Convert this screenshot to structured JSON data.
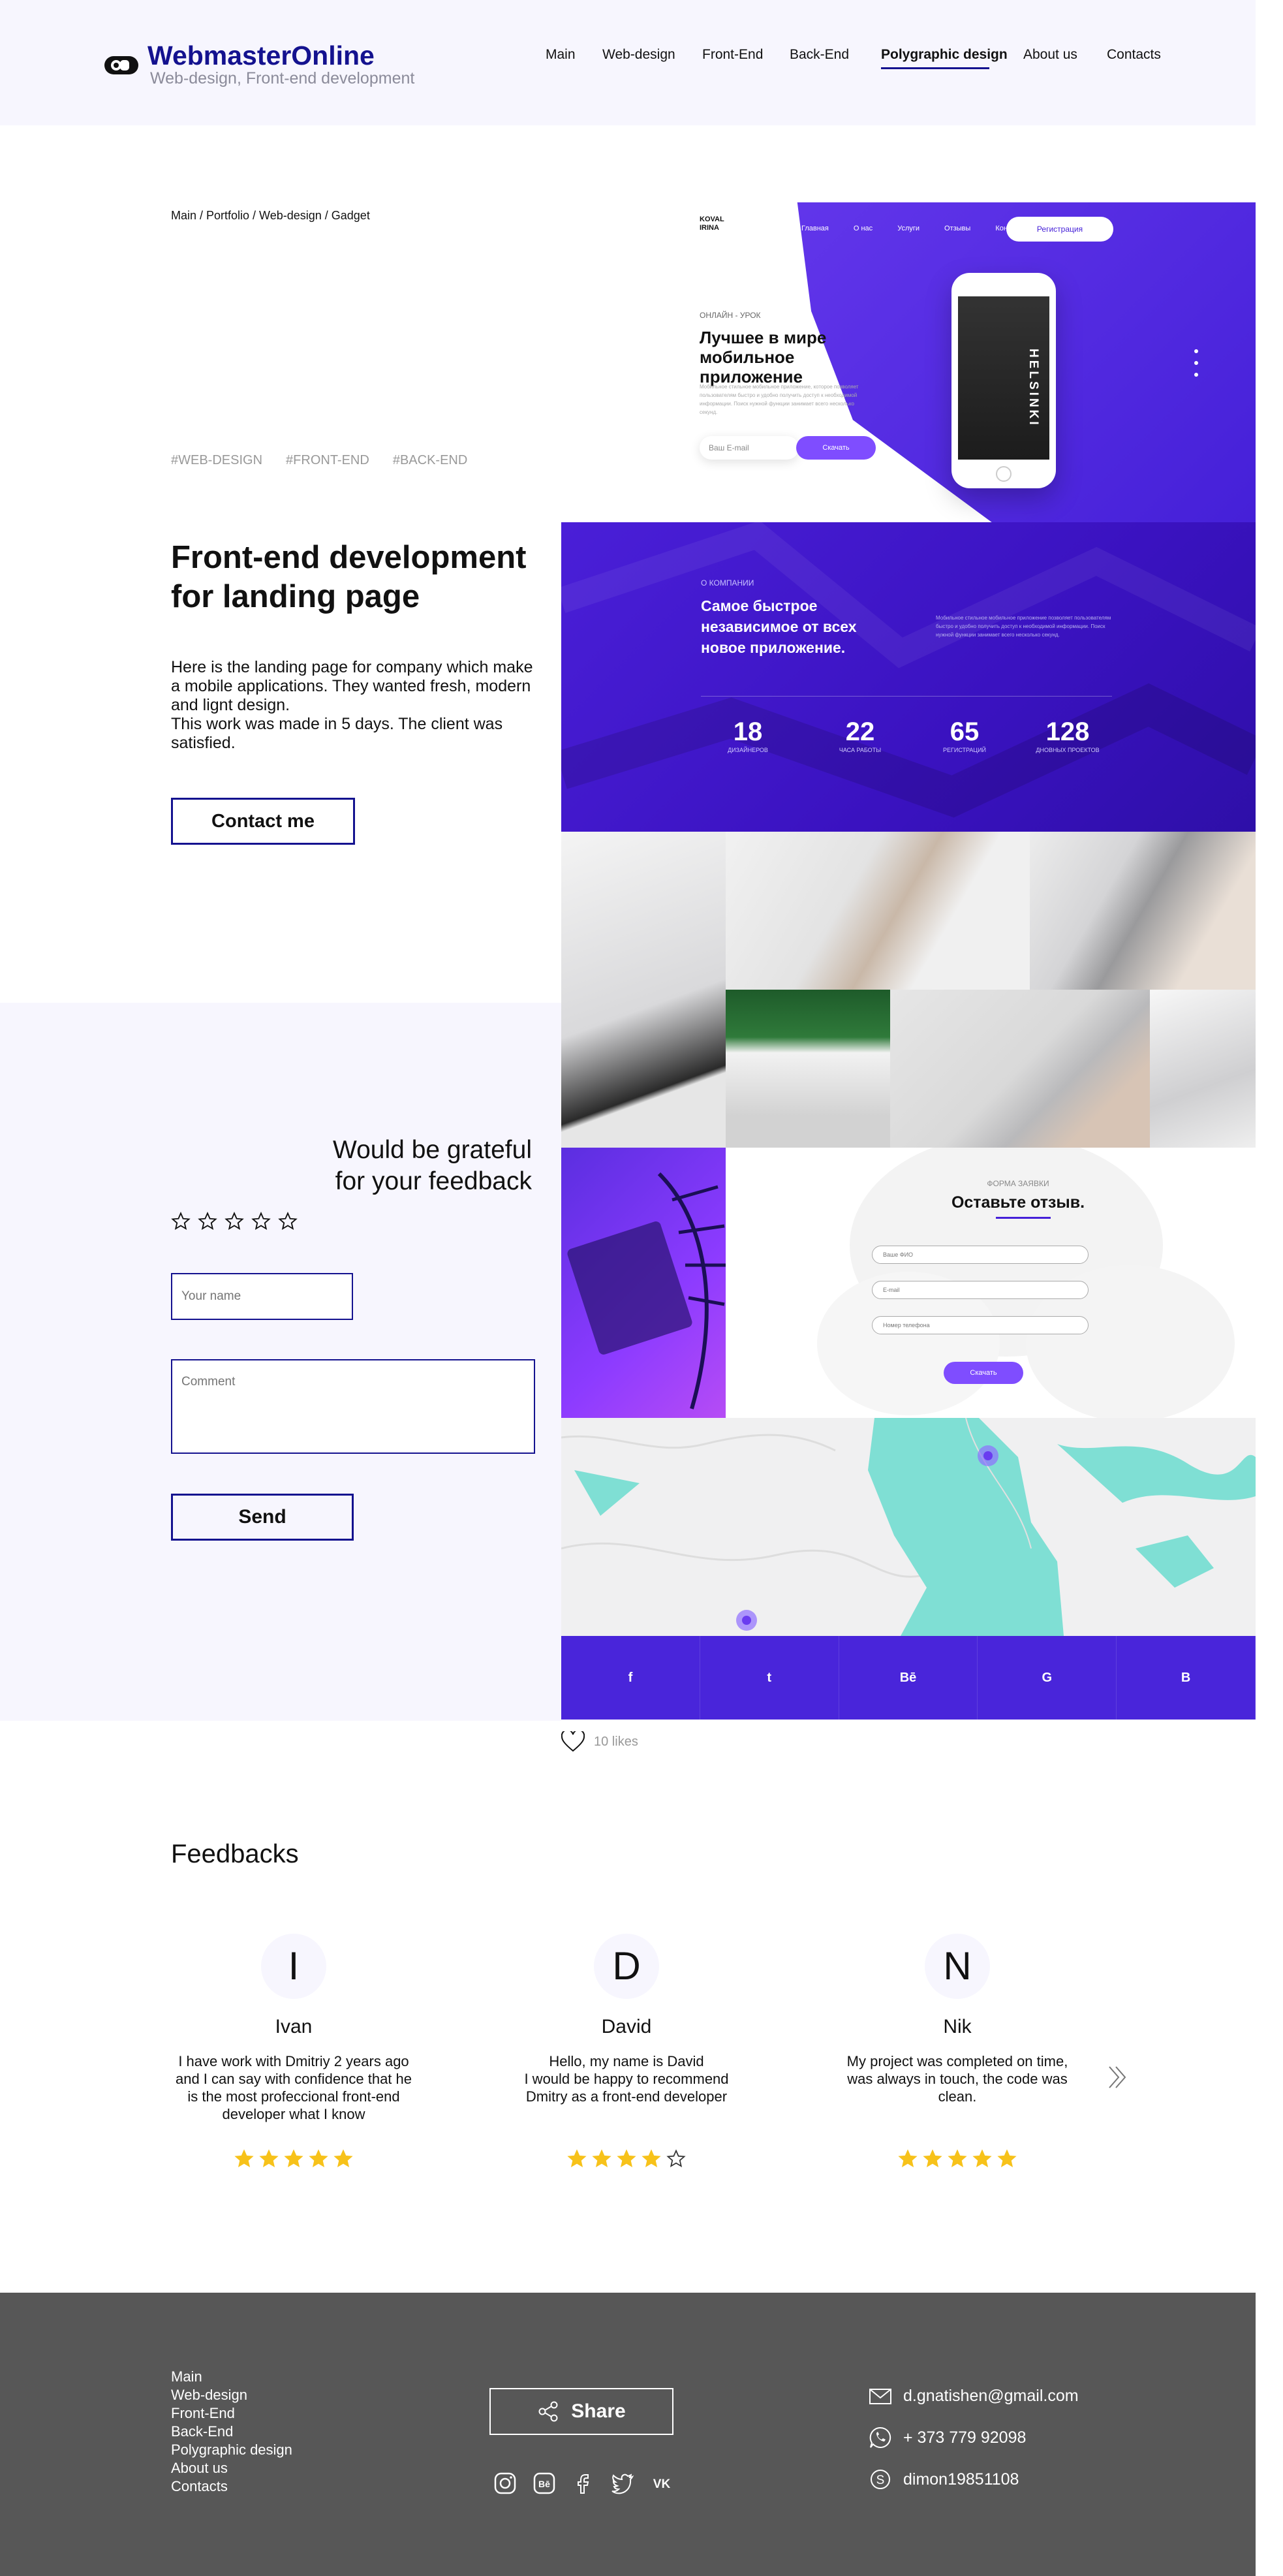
{
  "brand": {
    "title": "WebmasterOnline",
    "subtitle": "Web-design, Front-end development"
  },
  "nav": [
    {
      "label": "Main",
      "active": false
    },
    {
      "label": "Web-design",
      "active": false
    },
    {
      "label": "Front-End",
      "active": false
    },
    {
      "label": "Back-End",
      "active": false
    },
    {
      "label": "Polygraphic design",
      "active": true
    },
    {
      "label": "About us",
      "active": false
    },
    {
      "label": "Contacts",
      "active": false
    }
  ],
  "breadcrumb": "Main / Portfolio / Web-design / Gadget",
  "tags": [
    "#WEB-DESIGN",
    "#FRONT-END",
    "#BACK-END"
  ],
  "project": {
    "title": "Front-end development for landing page",
    "description": "Here is the landing page for company which make a mobile applications. They wanted fresh, modern and lignt design.\nThis work was made in 5 days. The client was satisfied.",
    "contact_label": "Contact me"
  },
  "feedback_form": {
    "heading": "Would be grateful for your feedback",
    "rating_max": 5,
    "name_placeholder": "Your name",
    "comment_placeholder": "Comment",
    "send_label": "Send"
  },
  "preview": {
    "logo": "KOVAL IRINA",
    "nav": [
      "Главная",
      "О нас",
      "Услуги",
      "Отзывы",
      "Контакты"
    ],
    "register": "Регистрация",
    "kicker": "ОНЛАЙН - УРОК",
    "headline": "Лучшее в мире мобильное приложение",
    "lead": "Мобильное стильное мобильное приложение, которое позволяет пользователям быстро и удобно получить доступ к необходимой информации. Поиск нужной функции занимает всего несколько секунд.",
    "email_placeholder": "Ваш E-mail",
    "download": "Скачать",
    "phone_text": "HELSINKI",
    "about_kicker": "О КОМПАНИИ",
    "about_title": "Самое быстрое независимое от всех новое приложение.",
    "about_text": "Мобильное стильное мобильное приложение позволяет пользователям быстро и удобно получить доступ к необходимой информации. Поиск нужной функции занимает всего несколько секунд.",
    "stats": [
      {
        "num": "18",
        "label": "ДИЗАЙНЕРОВ"
      },
      {
        "num": "22",
        "label": "ЧАСА РАБОТЫ"
      },
      {
        "num": "65",
        "label": "РЕГИСТРАЦИЙ"
      },
      {
        "num": "128",
        "label": "ДНОВНЫХ ПРОЕКТОВ"
      }
    ],
    "form_kicker": "ФОРМА ЗАЯВКИ",
    "form_title": "Оставьте отзыв.",
    "form_fields": [
      "Ваше ФИО",
      "E-mail",
      "Номер телефона"
    ],
    "form_send": "Скачать",
    "social": [
      "f",
      "t",
      "Bē",
      "G",
      "B"
    ]
  },
  "likes": {
    "count_label": "10 likes"
  },
  "feedbacks": {
    "title": "Feedbacks",
    "items": [
      {
        "initial": "I",
        "name": "Ivan",
        "text": "I have work with Dmitriy 2 years ago and I can say with confidence that he is the most profeccional front-end developer what I know",
        "rating": 5
      },
      {
        "initial": "D",
        "name": "David",
        "text": "Hello, my name is David\nI would be happy to recommend Dmitry as a front-end developer",
        "rating": 4
      },
      {
        "initial": "N",
        "name": "Nik",
        "text": "My project was completed on time, was always in touch, the code was clean.",
        "rating": 5
      }
    ]
  },
  "footer": {
    "links": [
      "Main",
      "Web-design",
      "Front-End",
      "Back-End",
      "Polygraphic design",
      "About us",
      "Contacts"
    ],
    "share_label": "Share",
    "social_icons": [
      "instagram-icon",
      "behance-icon",
      "facebook-icon",
      "twitter-icon",
      "vk-icon"
    ],
    "email": "d.gnatishen@gmail.com",
    "phone": "+ 373 779 92098",
    "skype": "dimon19851108"
  },
  "colors": {
    "brand": "#14128f",
    "accent": "#4925da",
    "star": "#f7c21a",
    "header_bg": "#f7f6fe",
    "footer_bg": "#575757"
  }
}
